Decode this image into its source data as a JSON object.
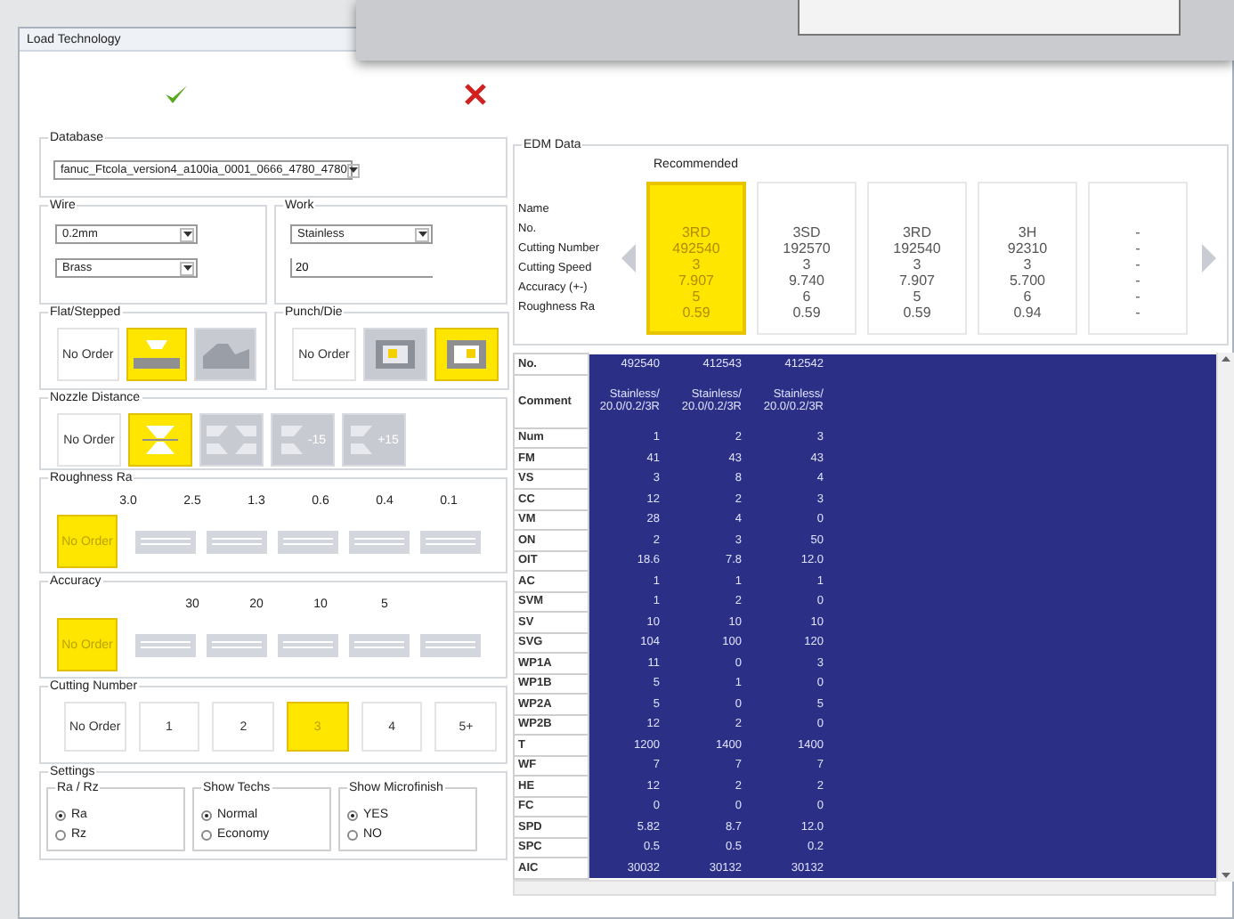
{
  "window": {
    "title": "Load Technology"
  },
  "database": {
    "label": "Database",
    "value": "fanuc_Ftcola_version4_a100ia_0001_0666_4780_4780"
  },
  "wire": {
    "label": "Wire",
    "diameter": "0.2mm",
    "material": "Brass"
  },
  "work": {
    "label": "Work",
    "material": "Stainless",
    "thickness": "20"
  },
  "flat_stepped": {
    "label": "Flat/Stepped",
    "options": [
      {
        "kind": "text",
        "label": "No Order",
        "selected": false
      },
      {
        "kind": "flat",
        "selected": true
      },
      {
        "kind": "stepped",
        "selected": false
      }
    ]
  },
  "punch_die": {
    "label": "Punch/Die",
    "options": [
      {
        "kind": "text",
        "label": "No Order",
        "selected": false
      },
      {
        "kind": "punch",
        "selected": false
      },
      {
        "kind": "die",
        "selected": true
      }
    ]
  },
  "nozzle_distance": {
    "label": "Nozzle Distance",
    "options": [
      {
        "kind": "text",
        "label": "No Order",
        "selected": false
      },
      {
        "kind": "close",
        "selected": true
      },
      {
        "kind": "split",
        "selected": false
      },
      {
        "kind": "offset",
        "label": "-15",
        "selected": false
      },
      {
        "kind": "offset",
        "label": "+15",
        "selected": false
      }
    ]
  },
  "roughness": {
    "label": "Roughness Ra",
    "ticks": [
      "3.0",
      "2.5",
      "1.3",
      "0.6",
      "0.4",
      "0.1"
    ],
    "options": [
      {
        "kind": "text",
        "label": "No Order",
        "selected": true
      },
      {
        "kind": "segment",
        "selected": false
      },
      {
        "kind": "segment",
        "selected": false
      },
      {
        "kind": "segment",
        "selected": false
      },
      {
        "kind": "segment",
        "selected": false
      },
      {
        "kind": "segment",
        "selected": false
      }
    ]
  },
  "accuracy": {
    "label": "Accuracy",
    "ticks": [
      "30",
      "20",
      "10",
      "5"
    ],
    "options": [
      {
        "kind": "text",
        "label": "No Order",
        "selected": true
      },
      {
        "kind": "segment",
        "selected": false
      },
      {
        "kind": "segment",
        "selected": false
      },
      {
        "kind": "segment",
        "selected": false
      },
      {
        "kind": "segment",
        "selected": false
      },
      {
        "kind": "segment",
        "selected": false
      }
    ]
  },
  "cutting_number": {
    "label": "Cutting Number",
    "options": [
      {
        "label": "No Order",
        "selected": false
      },
      {
        "label": "1",
        "selected": false
      },
      {
        "label": "2",
        "selected": false
      },
      {
        "label": "3",
        "selected": true
      },
      {
        "label": "4",
        "selected": false
      },
      {
        "label": "5+",
        "selected": false
      }
    ]
  },
  "settings": {
    "label": "Settings",
    "groups": [
      {
        "label": "Ra / Rz",
        "options": [
          {
            "label": "Ra",
            "selected": true
          },
          {
            "label": "Rz",
            "selected": false
          }
        ]
      },
      {
        "label": "Show Techs",
        "options": [
          {
            "label": "Normal",
            "selected": true
          },
          {
            "label": "Economy",
            "selected": false
          }
        ]
      },
      {
        "label": "Show Microfinish",
        "options": [
          {
            "label": "YES",
            "selected": true
          },
          {
            "label": "NO",
            "selected": false
          }
        ]
      }
    ]
  },
  "edm_data": {
    "label": "EDM Data",
    "recommended": "Recommended",
    "row_labels": [
      "Name",
      "No.",
      "Cutting Number",
      "Cutting Speed",
      "Accuracy (+-)",
      "Roughness Ra"
    ],
    "cards": [
      {
        "selected": true,
        "values": [
          "3RD",
          "492540",
          "3",
          "7.907",
          "5",
          "0.59"
        ]
      },
      {
        "selected": false,
        "values": [
          "3SD",
          "192570",
          "3",
          "9.740",
          "6",
          "0.59"
        ]
      },
      {
        "selected": false,
        "values": [
          "3RD",
          "192540",
          "3",
          "7.907",
          "5",
          "0.59"
        ]
      },
      {
        "selected": false,
        "values": [
          "3H",
          "92310",
          "3",
          "5.700",
          "6",
          "0.94"
        ]
      },
      {
        "selected": false,
        "values": [
          "-",
          "-",
          "-",
          "-",
          "-",
          "-"
        ]
      }
    ]
  },
  "table": {
    "rows": [
      {
        "label": "No.",
        "values": [
          "492540",
          "412543",
          "412542"
        ]
      },
      {
        "label": "Comment",
        "values": [
          "Stainless/\n20.0/0.2/3R",
          "Stainless/\n20.0/0.2/3R",
          "Stainless/\n20.0/0.2/3R"
        ]
      },
      {
        "label": "Num",
        "values": [
          "1",
          "2",
          "3"
        ]
      },
      {
        "label": "FM",
        "values": [
          "41",
          "43",
          "43"
        ]
      },
      {
        "label": "VS",
        "values": [
          "3",
          "8",
          "4"
        ]
      },
      {
        "label": "CC",
        "values": [
          "12",
          "2",
          "3"
        ]
      },
      {
        "label": "VM",
        "values": [
          "28",
          "4",
          "0"
        ]
      },
      {
        "label": "ON",
        "values": [
          "2",
          "3",
          "50"
        ]
      },
      {
        "label": "OIT",
        "values": [
          "18.6",
          "7.8",
          "12.0"
        ]
      },
      {
        "label": "AC",
        "values": [
          "1",
          "1",
          "1"
        ]
      },
      {
        "label": "SVM",
        "values": [
          "1",
          "2",
          "0"
        ]
      },
      {
        "label": "SV",
        "values": [
          "10",
          "10",
          "10"
        ]
      },
      {
        "label": "SVG",
        "values": [
          "104",
          "100",
          "120"
        ]
      },
      {
        "label": "WP1A",
        "values": [
          "11",
          "0",
          "3"
        ]
      },
      {
        "label": "WP1B",
        "values": [
          "5",
          "1",
          "0"
        ]
      },
      {
        "label": "WP2A",
        "values": [
          "5",
          "0",
          "5"
        ]
      },
      {
        "label": "WP2B",
        "values": [
          "12",
          "2",
          "0"
        ]
      },
      {
        "label": "T",
        "values": [
          "1200",
          "1400",
          "1400"
        ]
      },
      {
        "label": "WF",
        "values": [
          "7",
          "7",
          "7"
        ]
      },
      {
        "label": "HE",
        "values": [
          "12",
          "2",
          "2"
        ]
      },
      {
        "label": "FC",
        "values": [
          "0",
          "0",
          "0"
        ]
      },
      {
        "label": "SPD",
        "values": [
          "5.82",
          "8.7",
          "12.0"
        ]
      },
      {
        "label": "SPC",
        "values": [
          "0.5",
          "0.5",
          "0.2"
        ]
      },
      {
        "label": "AIC",
        "values": [
          "30032",
          "30132",
          "30132"
        ]
      }
    ]
  }
}
